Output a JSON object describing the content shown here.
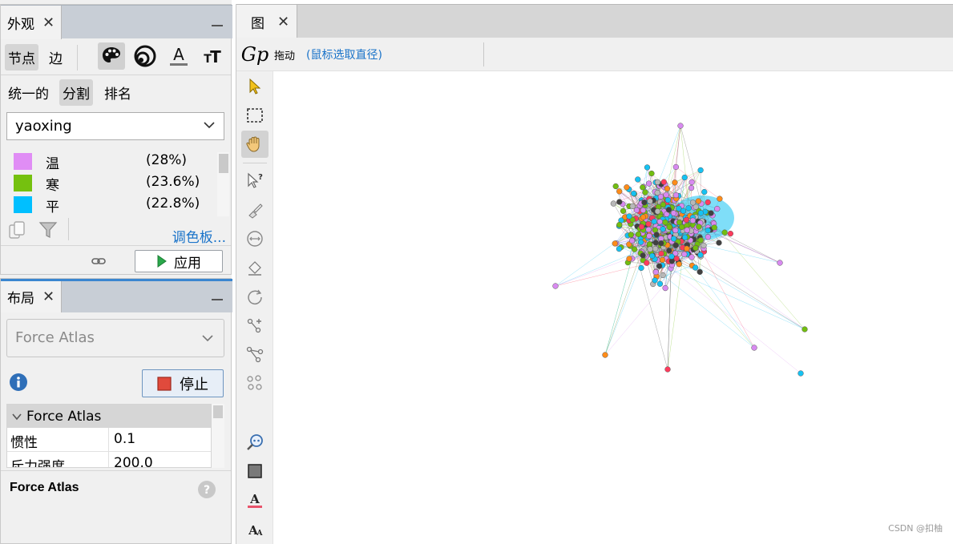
{
  "appearance_panel": {
    "tab_title": "外观",
    "close": "✕",
    "tabs": {
      "nodes": "节点",
      "edges": "边"
    },
    "icon_tools": [
      "palette-icon",
      "size-icon",
      "label-color-icon",
      "label-size-icon"
    ],
    "modes": {
      "unique": "统一的",
      "partition": "分割",
      "ranking": "排名"
    },
    "partition_attribute": "yaoxing",
    "legend": [
      {
        "name": "温",
        "percent": "(28%)",
        "color": "#e08df5"
      },
      {
        "name": "寒",
        "percent": "(23.6%)",
        "color": "#75c10f"
      },
      {
        "name": "平",
        "percent": "(22.8%)",
        "color": "#00bfff"
      }
    ],
    "palette_link": "调色板...",
    "apply_label": "应用"
  },
  "layout_panel": {
    "tab_title": "布局",
    "close": "✕",
    "algorithm": "Force Atlas",
    "stop_label": "停止",
    "properties_group": "Force Atlas",
    "properties": [
      {
        "key": "惯性",
        "value": "0.1"
      },
      {
        "key": "斥力强度",
        "value": "200.0"
      }
    ],
    "description_title": "Force Atlas"
  },
  "graph_window": {
    "tab_title": "图",
    "close": "✕",
    "logo": "Gp",
    "mode": "拖动",
    "mode_hint": "(鼠标选取直径)",
    "colors": {
      "purple": "#d88af0",
      "green": "#72be10",
      "cyan": "#16c2f2",
      "dark": "#404040",
      "orange": "#ff8c1a",
      "red": "#ff3b5c",
      "gray": "#b8b8b8"
    }
  },
  "watermark": "CSDN @扣柚"
}
